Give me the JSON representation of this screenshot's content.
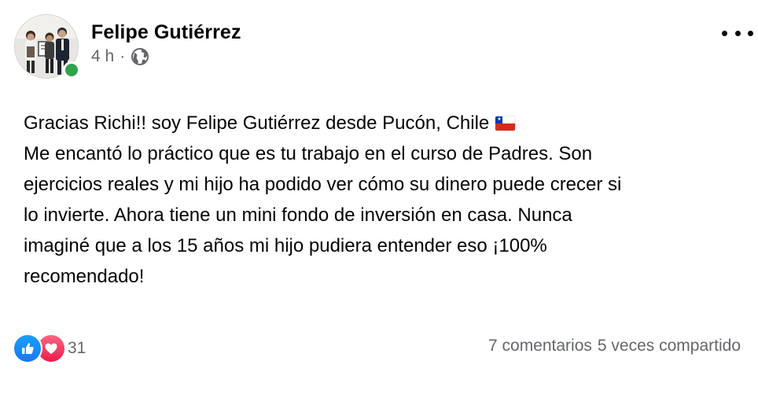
{
  "post": {
    "author": {
      "name": "Felipe Gutiérrez",
      "online": true
    },
    "timestamp": "4 h",
    "separator": "·",
    "audience_icon": "globe-icon",
    "menu_icon": "more-options-icon",
    "body_lines": [
      "Gracias Richi!! soy Felipe Gutiérrez desde Pucón, Chile",
      "Me encantó lo práctico que es tu trabajo en el curso de Padres. Son",
      "ejercicios reales y mi hijo ha podido ver cómo su dinero puede crecer si",
      "lo invierte. Ahora tiene un mini fondo de inversión en casa. Nunca",
      "imaginé que a los 15 años mi hijo pudiera entender eso ¡100%",
      "recomendado!"
    ],
    "emoji": "chile-flag",
    "reactions": {
      "types": [
        "like",
        "love"
      ],
      "count": "31"
    },
    "comments": "7 comentarios",
    "shares": "5 veces compartido"
  },
  "colors": {
    "text": "#050505",
    "secondary_text": "#65676b",
    "online": "#31a24c",
    "like": "#1877f2",
    "love": "#e61e4d"
  }
}
